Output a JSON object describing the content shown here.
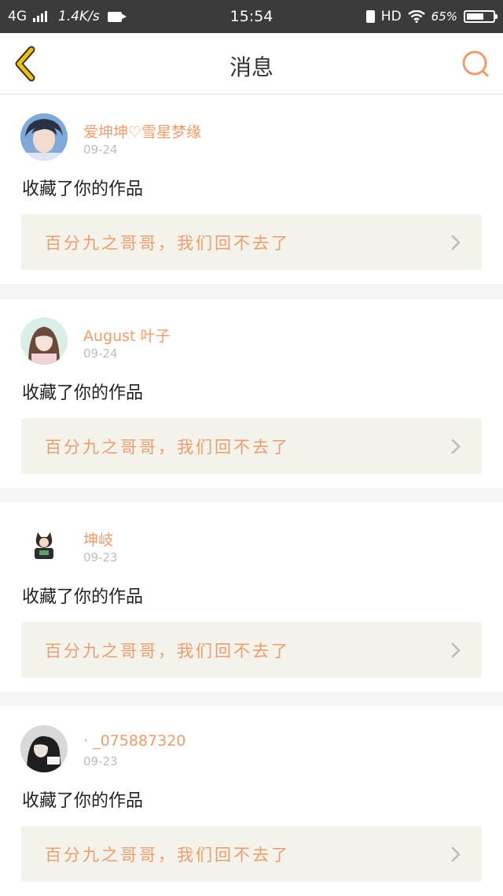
{
  "status_bar": {
    "network": "4G",
    "speed": "1.4K/s",
    "time": "15:54",
    "hd": "HD",
    "battery_label": "65%",
    "battery_level": 0.65
  },
  "header": {
    "title": "消息"
  },
  "messages": [
    {
      "user": "爱坤坤♡雪星梦缘",
      "date": "09-24",
      "action": "收藏了你的作品",
      "work_title": "百分九之哥哥，我们回不去了"
    },
    {
      "user": "August 叶子",
      "date": "09-24",
      "action": "收藏了你的作品",
      "work_title": "百分九之哥哥，我们回不去了"
    },
    {
      "user": "坤岐",
      "date": "09-23",
      "action": "收藏了你的作品",
      "work_title": "百分九之哥哥，我们回不去了"
    },
    {
      "user": "· _075887320",
      "date": "09-23",
      "action": "收藏了你的作品",
      "work_title": "百分九之哥哥，我们回不去了"
    }
  ],
  "colors": {
    "accent": "#f09c6a",
    "back_icon": "#f2c200",
    "card_link_bg": "#f3f3ec"
  },
  "icons": {
    "back": "back-chevron-icon",
    "search": "search-icon",
    "item_chevron": "chevron-right-icon"
  }
}
